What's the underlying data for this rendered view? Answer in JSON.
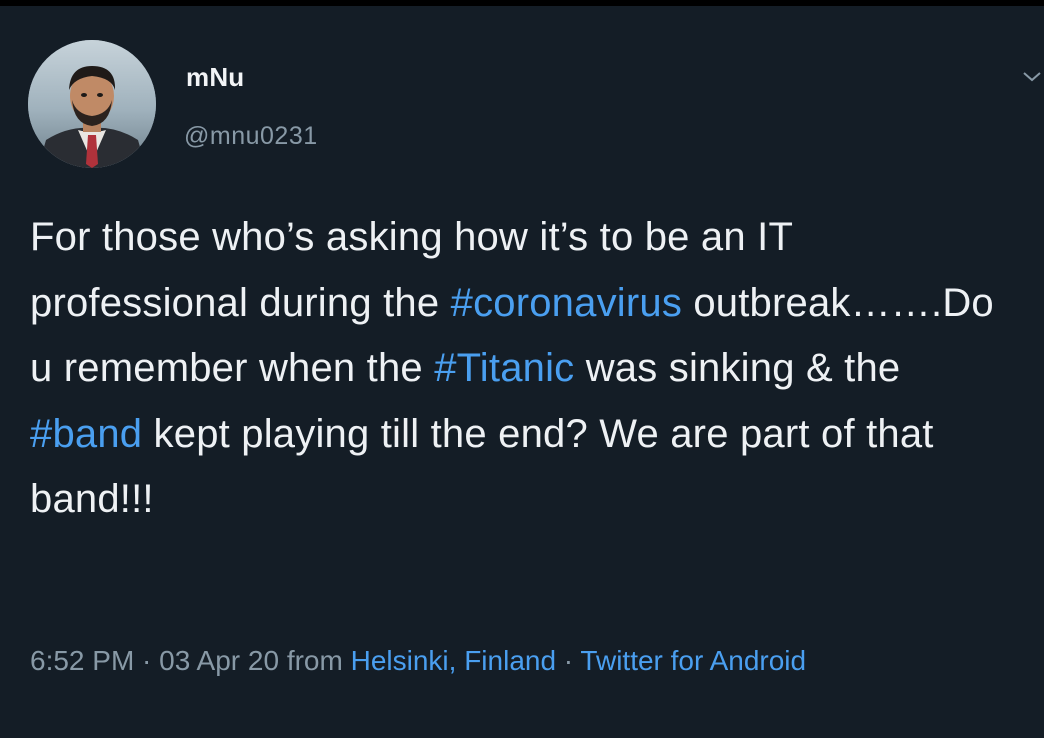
{
  "user": {
    "name": "mNu",
    "handle": "@mnu0231"
  },
  "tweet": {
    "segments": [
      {
        "text": "For those who’s asking how it’s to be an IT professional during the ",
        "kind": "text"
      },
      {
        "text": "#coronavirus",
        "kind": "hashtag"
      },
      {
        "text": " outbreak…….Do u remember when the ",
        "kind": "text"
      },
      {
        "text": "#Titanic",
        "kind": "hashtag"
      },
      {
        "text": " was sinking & the ",
        "kind": "text"
      },
      {
        "text": "#band",
        "kind": "hashtag"
      },
      {
        "text": " kept playing till the end? We are part of that band!!!",
        "kind": "text"
      }
    ]
  },
  "meta": {
    "time": "6:52 PM",
    "sep": " · ",
    "date": "03 Apr 20",
    "from_word": " from ",
    "location": "Helsinki, Finland",
    "client": "Twitter for Android"
  },
  "colors": {
    "background": "#141d26",
    "link": "#4a9ff0",
    "secondary_text": "#8899a6"
  },
  "icons": {
    "menu": "chevron-down-icon"
  }
}
